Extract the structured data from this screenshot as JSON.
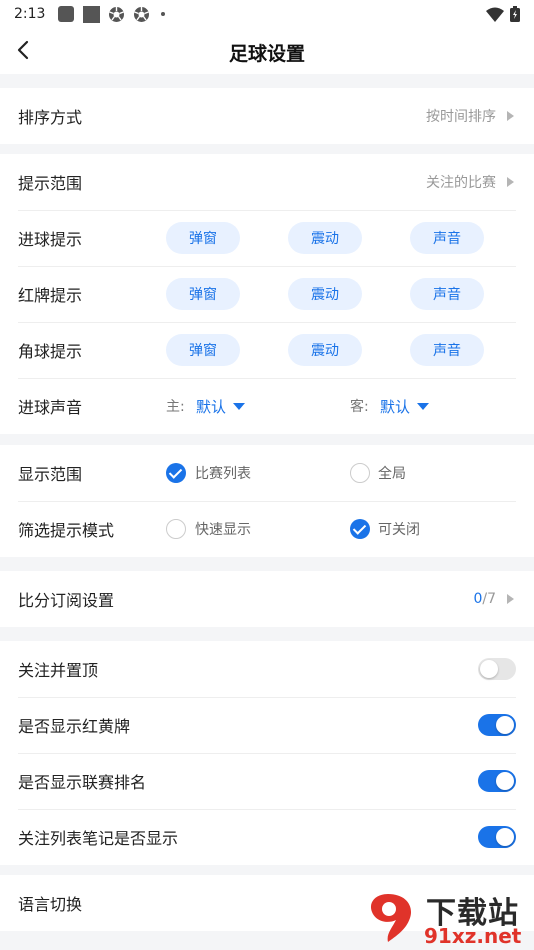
{
  "status_bar": {
    "time": "2:13"
  },
  "header": {
    "title": "足球设置"
  },
  "sort": {
    "label": "排序方式",
    "value": "按时间排序"
  },
  "alerts": {
    "scope_label": "提示范围",
    "scope_value": "关注的比赛",
    "goal_label": "进球提示",
    "red_label": "红牌提示",
    "corner_label": "角球提示",
    "chips": [
      "弹窗",
      "震动",
      "声音"
    ],
    "sound": {
      "label": "进球声音",
      "home_label": "主:",
      "home_value": "默认",
      "away_label": "客:",
      "away_value": "默认"
    }
  },
  "display": {
    "range_label": "显示范围",
    "range_options": [
      {
        "label": "比赛列表",
        "checked": true
      },
      {
        "label": "全局",
        "checked": false
      }
    ],
    "filter_label": "筛选提示模式",
    "filter_options": [
      {
        "label": "快速显示",
        "checked": false
      },
      {
        "label": "可关闭",
        "checked": true
      }
    ]
  },
  "subscription": {
    "label": "比分订阅设置",
    "count": "0",
    "total": "/7"
  },
  "toggles": [
    {
      "label": "关注并置顶",
      "on": false
    },
    {
      "label": "是否显示红黄牌",
      "on": true
    },
    {
      "label": "是否显示联赛排名",
      "on": true
    },
    {
      "label": "关注列表笔记是否显示",
      "on": true
    }
  ],
  "language": {
    "label": "语言切换"
  },
  "watermark": {
    "top": "下载站",
    "bottom": "91xz.net"
  },
  "colors": {
    "accent": "#1a73e8",
    "chip_bg": "#e8f1ff",
    "background": "#f4f5f7"
  }
}
